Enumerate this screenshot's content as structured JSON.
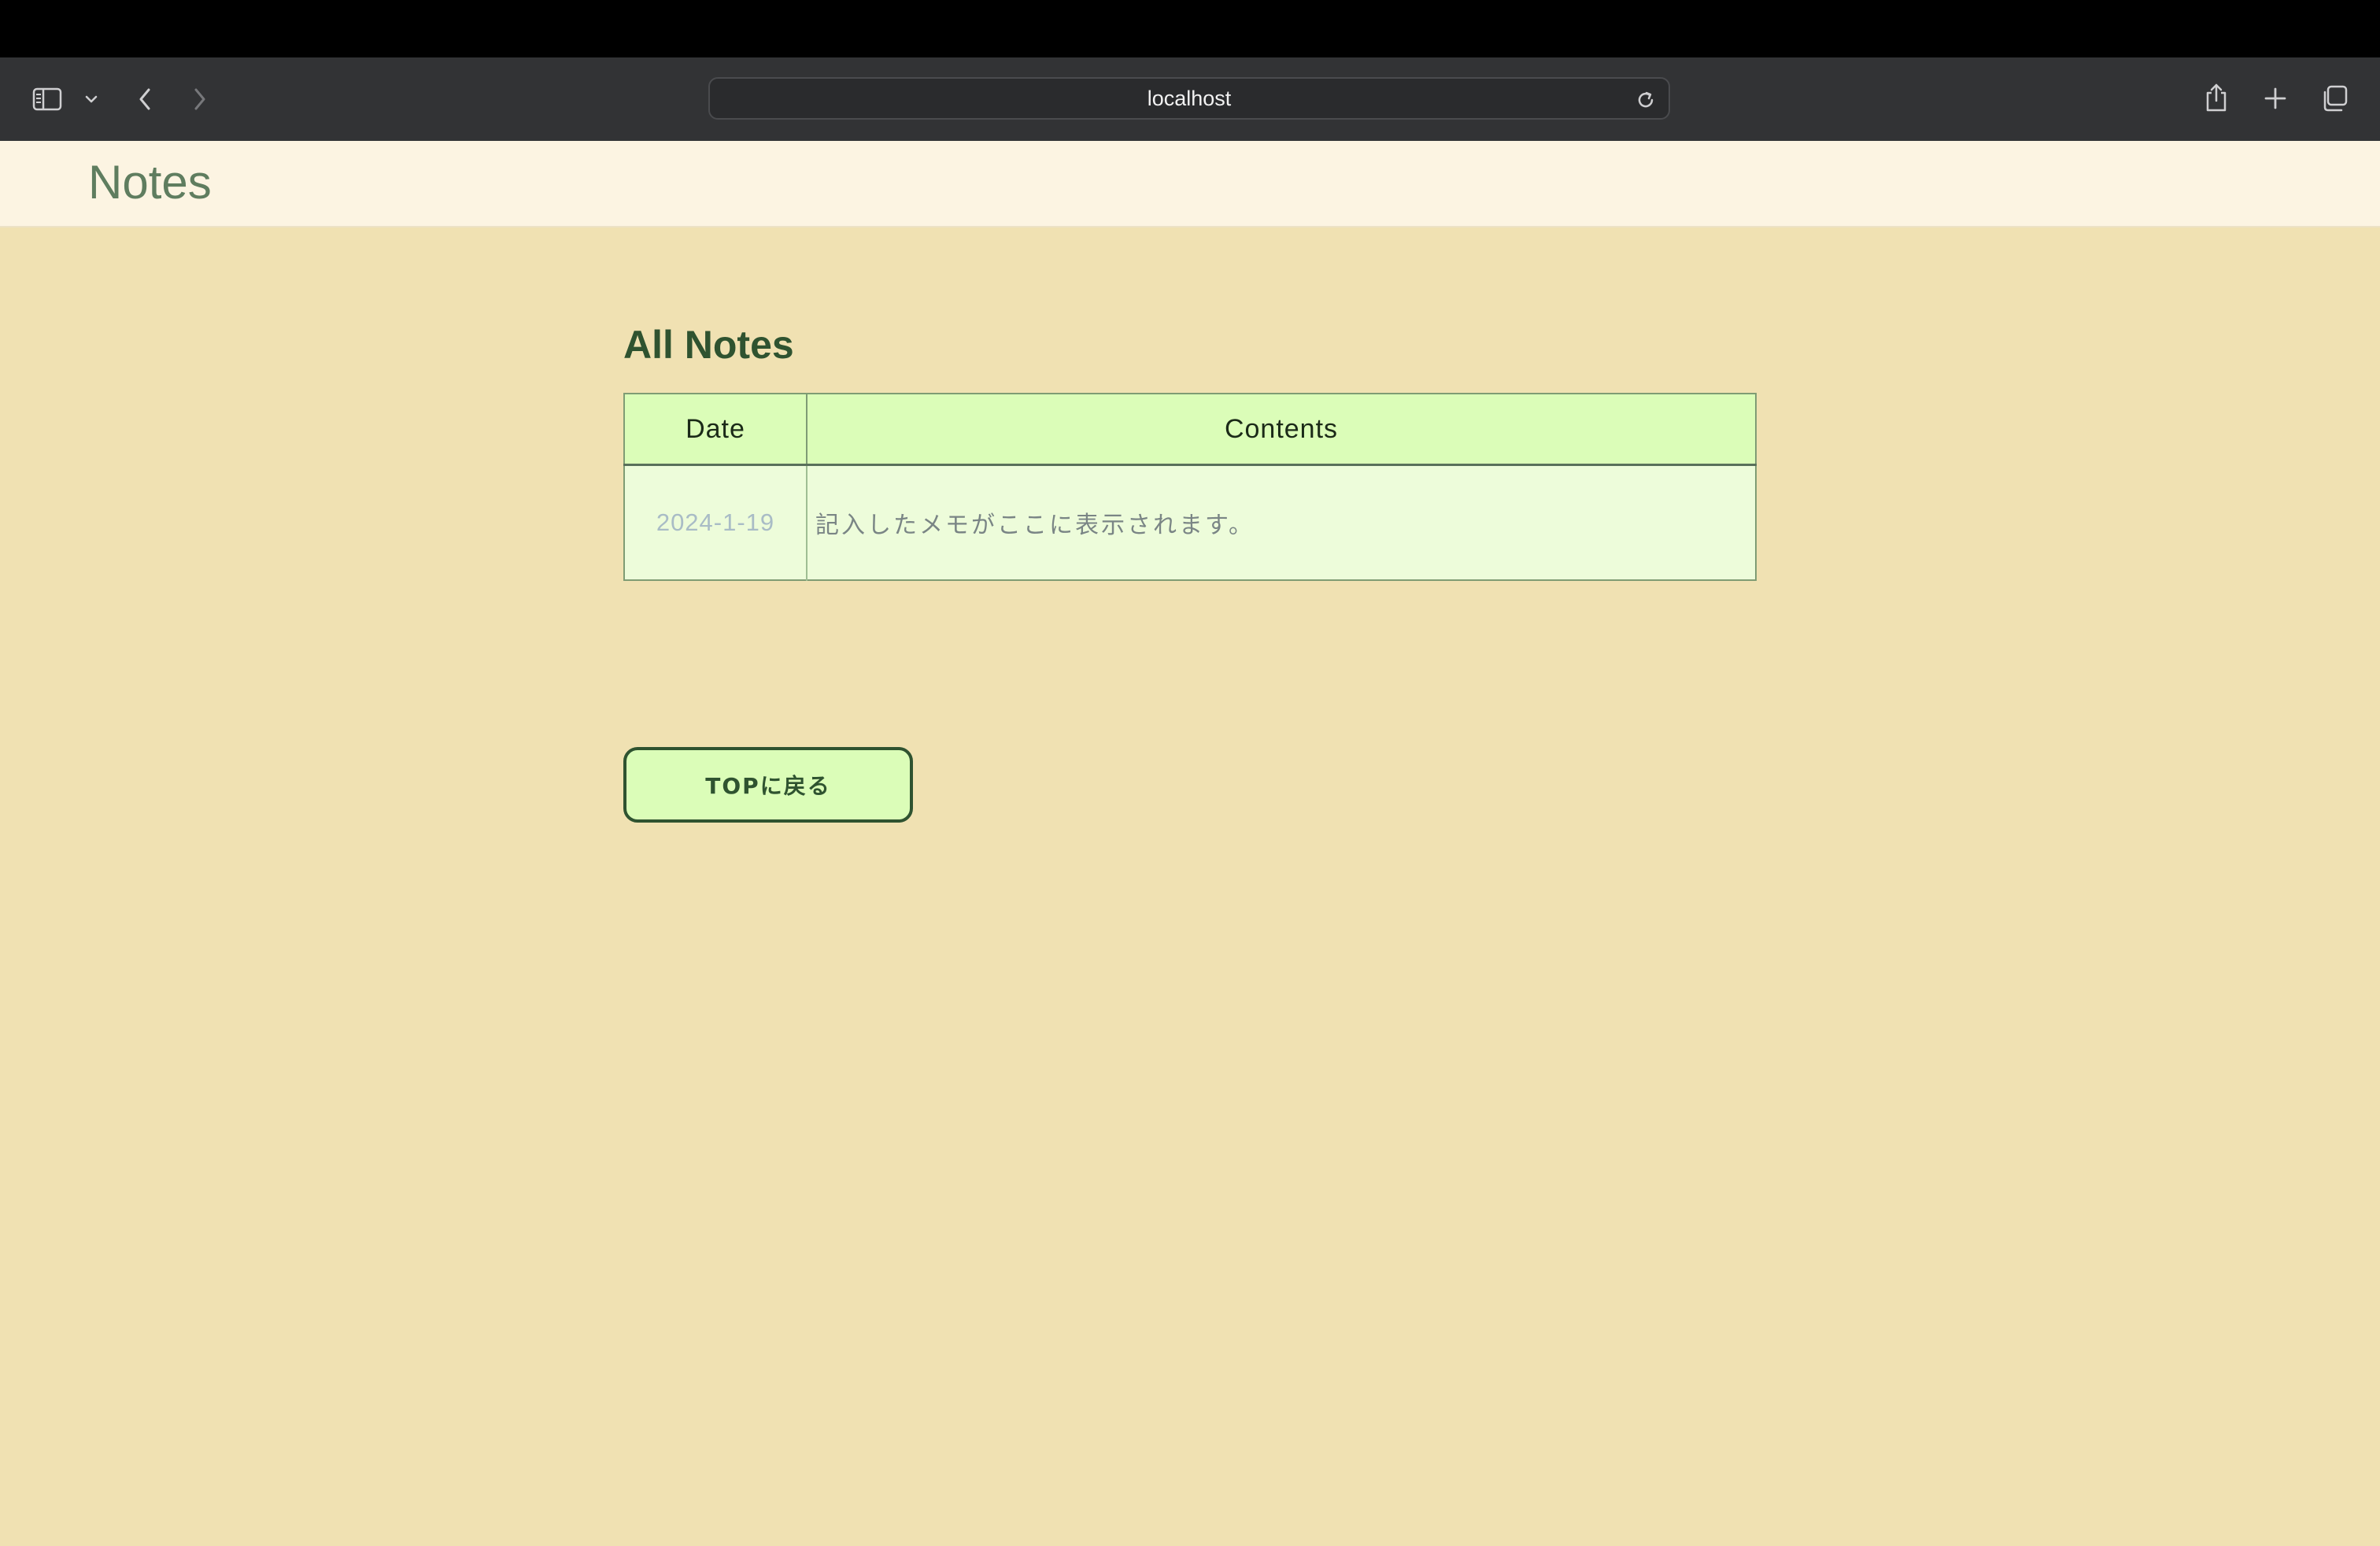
{
  "browser": {
    "url": "localhost",
    "icons": {
      "sidebar": "sidebar-icon",
      "sidebar_menu": "chevron-down-icon",
      "back": "chevron-left-icon",
      "forward": "chevron-right-icon",
      "reload": "reload-icon",
      "share": "share-icon",
      "new_tab": "plus-icon",
      "tab_overview": "tabs-icon"
    }
  },
  "header": {
    "title": "Notes"
  },
  "main": {
    "heading": "All Notes",
    "table": {
      "columns": [
        "Date",
        "Contents"
      ],
      "rows": [
        {
          "date": "2024-1-19",
          "contents": "記入したメモがここに表示されます。"
        }
      ]
    },
    "back_button_label": "TOPに戻る"
  },
  "colors": {
    "page_background": "#f0e1b2",
    "header_background": "#fcf4e2",
    "accent_green": "#2f5330",
    "table_header": "#dbfdb8",
    "table_cell": "#edfcda"
  }
}
